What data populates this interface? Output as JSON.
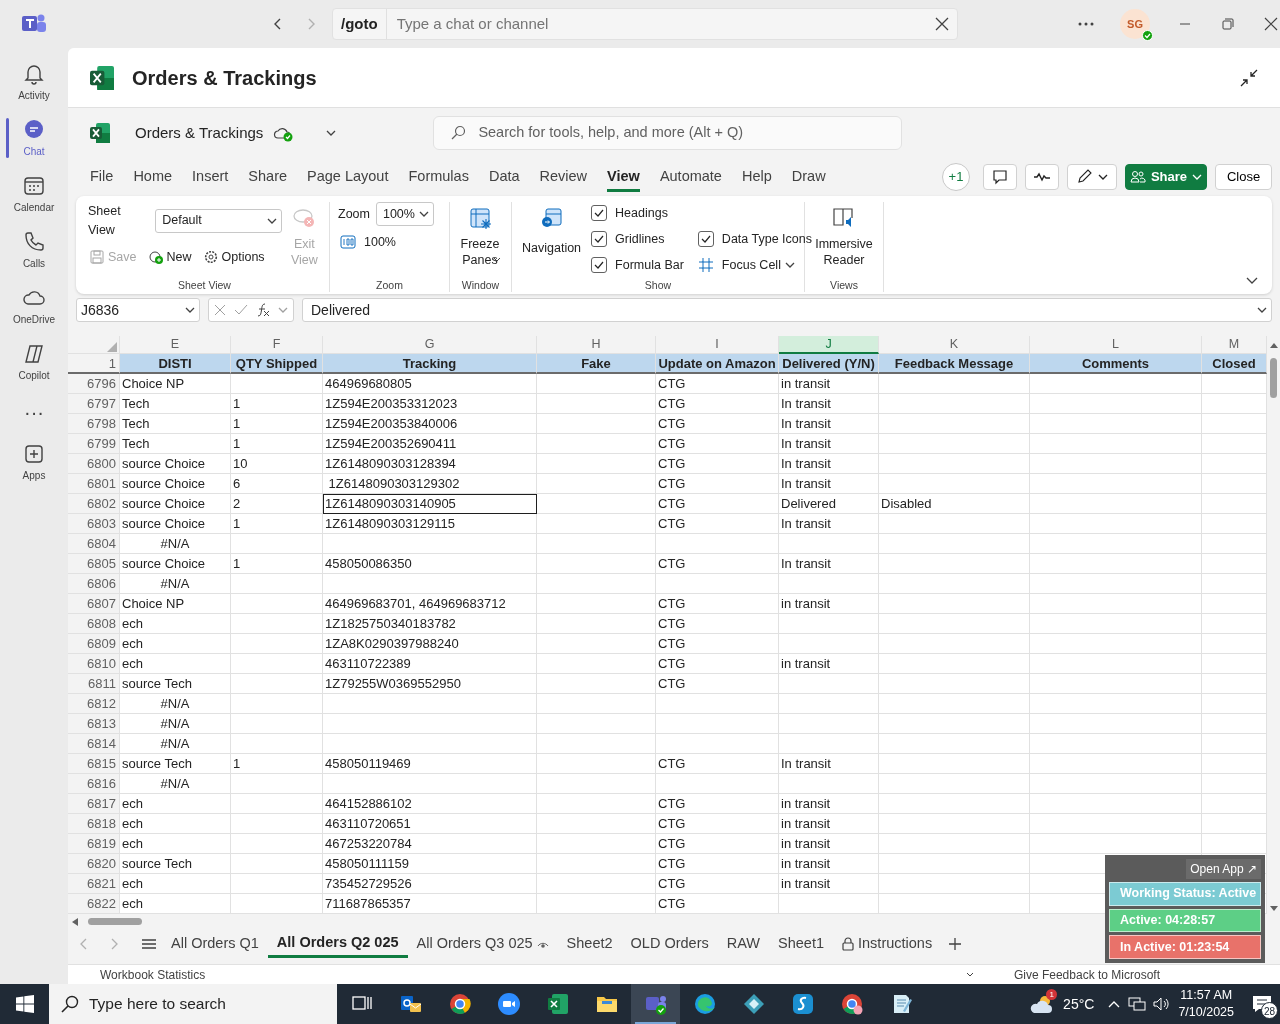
{
  "teams_bar": {
    "goto": "/goto",
    "search_placeholder": "Type a chat or channel",
    "avatar": "SG"
  },
  "rail": [
    {
      "label": "Activity",
      "kind": "bell",
      "selected": false
    },
    {
      "label": "Chat",
      "kind": "chat",
      "selected": true
    },
    {
      "label": "Calendar",
      "kind": "calendar",
      "selected": false
    },
    {
      "label": "Calls",
      "kind": "phone",
      "selected": false
    },
    {
      "label": "OneDrive",
      "kind": "cloud",
      "selected": false
    },
    {
      "label": "Copilot",
      "kind": "copilot",
      "selected": false
    },
    {
      "label": "···",
      "kind": "more",
      "selected": false
    },
    {
      "label": "Apps",
      "kind": "apps",
      "selected": false
    }
  ],
  "app_title": "Orders & Trackings",
  "workbook": {
    "name": "Orders & Trackings",
    "search_placeholder": "Search for tools, help, and more (Alt + Q)"
  },
  "menu_tabs": [
    {
      "label": "File",
      "selected": false
    },
    {
      "label": "Home",
      "selected": false
    },
    {
      "label": "Insert",
      "selected": false
    },
    {
      "label": "Share",
      "selected": false
    },
    {
      "label": "Page Layout",
      "selected": false
    },
    {
      "label": "Formulas",
      "selected": false
    },
    {
      "label": "Data",
      "selected": false
    },
    {
      "label": "Review",
      "selected": false
    },
    {
      "label": "View",
      "selected": true
    },
    {
      "label": "Automate",
      "selected": false
    },
    {
      "label": "Help",
      "selected": false
    },
    {
      "label": "Draw",
      "selected": false
    }
  ],
  "toolbar": {
    "collaborators": "+1",
    "share": "Share",
    "close": "Close"
  },
  "ribbon": {
    "sheet_view": {
      "label": "Sheet View",
      "select": "Default",
      "buttons": [
        {
          "label": "Save",
          "kind": "save",
          "disabled": true
        },
        {
          "label": "New",
          "kind": "new",
          "disabled": false
        },
        {
          "label": "Options",
          "kind": "options",
          "disabled": false
        }
      ],
      "exit": {
        "label": "Exit View",
        "disabled": true
      },
      "group": "Sheet View"
    },
    "zoom": {
      "label": "Zoom",
      "select": "100%",
      "reset": "100%",
      "group": "Zoom"
    },
    "window": {
      "button": "Freeze Panes",
      "group": "Window"
    },
    "show": {
      "navigation": "Navigation",
      "checks": [
        {
          "label": "Headings",
          "checked": true
        },
        {
          "label": "Gridlines",
          "checked": true
        },
        {
          "label": "Formula Bar",
          "checked": true
        },
        {
          "label": "Data Type Icons",
          "checked": true
        }
      ],
      "focus_cell": "Focus Cell",
      "group": "Show"
    },
    "views": {
      "button": "Immersive Reader",
      "group": "Views"
    }
  },
  "formula_bar": {
    "name_box": "J6836",
    "formula": "Delivered"
  },
  "sheet": {
    "header_row": "1",
    "columns": [
      {
        "letter": "E",
        "header": "DISTI",
        "selected": false
      },
      {
        "letter": "F",
        "header": "QTY Shipped",
        "selected": false
      },
      {
        "letter": "G",
        "header": "Tracking",
        "selected": false
      },
      {
        "letter": "H",
        "header": "Fake",
        "selected": false
      },
      {
        "letter": "I",
        "header": "Update on Amazon",
        "selected": false
      },
      {
        "letter": "J",
        "header": "Delivered (Y/N)",
        "selected": true
      },
      {
        "letter": "K",
        "header": "Feedback Message",
        "selected": false
      },
      {
        "letter": "L",
        "header": "Comments",
        "selected": false
      },
      {
        "letter": "M",
        "header": "Closed",
        "selected": false
      }
    ],
    "rows": [
      {
        "num": "6796",
        "kind": "data",
        "g_cell_selected": false,
        "cells": [
          "Choice NP",
          null,
          "464969680805",
          null,
          "CTG",
          "in transit",
          null,
          null,
          null
        ]
      },
      {
        "num": "6797",
        "kind": "data",
        "g_cell_selected": false,
        "cells": [
          "Tech",
          "1",
          "1Z594E200353312023",
          null,
          "CTG",
          "In transit",
          null,
          null,
          null
        ]
      },
      {
        "num": "6798",
        "kind": "data",
        "g_cell_selected": false,
        "cells": [
          "Tech",
          "1",
          "1Z594E200353840006",
          null,
          "CTG",
          "In transit",
          null,
          null,
          null
        ]
      },
      {
        "num": "6799",
        "kind": "data",
        "g_cell_selected": false,
        "cells": [
          "Tech",
          "1",
          "1Z594E200352690411",
          null,
          "CTG",
          "In transit",
          null,
          null,
          null
        ]
      },
      {
        "num": "6800",
        "kind": "data",
        "g_cell_selected": false,
        "cells": [
          "source Choice",
          "10",
          "1Z6148090303128394",
          null,
          "CTG",
          "In transit",
          null,
          null,
          null
        ]
      },
      {
        "num": "6801",
        "kind": "data",
        "g_cell_selected": false,
        "cells": [
          "source Choice",
          "6",
          " 1Z6148090303129302",
          null,
          "CTG",
          "In transit",
          null,
          null,
          null
        ]
      },
      {
        "num": "6802",
        "kind": "data",
        "g_cell_selected": true,
        "cells": [
          "source Choice",
          "2",
          "1Z6148090303140905",
          null,
          "CTG",
          "Delivered",
          "Disabled",
          null,
          null
        ]
      },
      {
        "num": "6803",
        "kind": "data",
        "g_cell_selected": false,
        "cells": [
          "source Choice",
          "1",
          "1Z6148090303129115",
          null,
          "CTG",
          "In transit",
          null,
          null,
          null
        ]
      },
      {
        "num": "6804",
        "kind": "error",
        "g_cell_selected": false,
        "cells": [
          "#N/A",
          null,
          null,
          null,
          null,
          null,
          null,
          null,
          null
        ]
      },
      {
        "num": "6805",
        "kind": "data",
        "g_cell_selected": false,
        "cells": [
          "source Choice",
          "1",
          "458050086350",
          null,
          "CTG",
          "In transit",
          null,
          null,
          null
        ]
      },
      {
        "num": "6806",
        "kind": "error",
        "g_cell_selected": false,
        "cells": [
          "#N/A",
          null,
          null,
          null,
          null,
          null,
          null,
          null,
          null
        ]
      },
      {
        "num": "6807",
        "kind": "data",
        "g_cell_selected": false,
        "cells": [
          "Choice NP",
          null,
          "464969683701, 464969683712",
          null,
          "CTG",
          "in transit",
          null,
          null,
          null
        ]
      },
      {
        "num": "6808",
        "kind": "data",
        "g_cell_selected": false,
        "cells": [
          "ech",
          null,
          "1Z1825750340183782",
          null,
          "CTG",
          null,
          null,
          null,
          null
        ]
      },
      {
        "num": "6809",
        "kind": "data",
        "g_cell_selected": false,
        "cells": [
          "ech",
          null,
          "1ZA8K0290397988240",
          null,
          "CTG",
          null,
          null,
          null,
          null
        ]
      },
      {
        "num": "6810",
        "kind": "data",
        "g_cell_selected": false,
        "cells": [
          "ech",
          null,
          "463110722389",
          null,
          "CTG",
          "in transit",
          null,
          null,
          null
        ]
      },
      {
        "num": "6811",
        "kind": "data",
        "g_cell_selected": false,
        "cells": [
          "source Tech",
          null,
          "1Z79255W0369552950",
          null,
          "CTG",
          null,
          null,
          null,
          null
        ]
      },
      {
        "num": "6812",
        "kind": "error",
        "g_cell_selected": false,
        "cells": [
          "#N/A",
          null,
          null,
          null,
          null,
          null,
          null,
          null,
          null
        ]
      },
      {
        "num": "6813",
        "kind": "error",
        "g_cell_selected": false,
        "cells": [
          "#N/A",
          null,
          null,
          null,
          null,
          null,
          null,
          null,
          null
        ]
      },
      {
        "num": "6814",
        "kind": "error",
        "g_cell_selected": false,
        "cells": [
          "#N/A",
          null,
          null,
          null,
          null,
          null,
          null,
          null,
          null
        ]
      },
      {
        "num": "6815",
        "kind": "data",
        "g_cell_selected": false,
        "cells": [
          "source Tech",
          "1",
          "458050119469",
          null,
          "CTG",
          "In transit",
          null,
          null,
          null
        ]
      },
      {
        "num": "6816",
        "kind": "error",
        "g_cell_selected": false,
        "cells": [
          "#N/A",
          null,
          null,
          null,
          null,
          null,
          null,
          null,
          null
        ]
      },
      {
        "num": "6817",
        "kind": "data",
        "g_cell_selected": false,
        "cells": [
          "ech",
          null,
          "464152886102",
          null,
          "CTG",
          "in transit",
          null,
          null,
          null
        ]
      },
      {
        "num": "6818",
        "kind": "data",
        "g_cell_selected": false,
        "cells": [
          "ech",
          null,
          "463110720651",
          null,
          "CTG",
          "in transit",
          null,
          null,
          null
        ]
      },
      {
        "num": "6819",
        "kind": "data",
        "g_cell_selected": false,
        "cells": [
          "ech",
          null,
          "467253220784",
          null,
          "CTG",
          "in transit",
          null,
          null,
          null
        ]
      },
      {
        "num": "6820",
        "kind": "data",
        "g_cell_selected": false,
        "cells": [
          "source Tech",
          null,
          "458050111159",
          null,
          "CTG",
          "in transit",
          null,
          null,
          null
        ]
      },
      {
        "num": "6821",
        "kind": "data",
        "g_cell_selected": false,
        "cells": [
          "ech",
          null,
          "735452729526",
          null,
          "CTG",
          "in transit",
          null,
          null,
          null
        ]
      },
      {
        "num": "6822",
        "kind": "data",
        "g_cell_selected": false,
        "cells": [
          "ech",
          null,
          "711687865357",
          null,
          "CTG",
          null,
          null,
          null,
          null
        ]
      }
    ]
  },
  "sheet_tabs": [
    {
      "label": "All Orders Q1",
      "kind": "plain",
      "selected": false
    },
    {
      "label": "All Orders Q2 025",
      "kind": "plain",
      "selected": true
    },
    {
      "label": "All Orders Q3 025",
      "kind": "viewed",
      "selected": false
    },
    {
      "label": "Sheet2",
      "kind": "plain",
      "selected": false
    },
    {
      "label": "OLD Orders",
      "kind": "plain",
      "selected": false
    },
    {
      "label": "RAW",
      "kind": "plain",
      "selected": false
    },
    {
      "label": "Sheet1",
      "kind": "plain",
      "selected": false
    },
    {
      "label": "Instructions",
      "kind": "locked",
      "selected": false
    }
  ],
  "status_bar": {
    "left": "Workbook Statistics",
    "feedback": "Give Feedback to Microsoft"
  },
  "status_widget": {
    "open": "Open App ↗",
    "items": [
      {
        "label": "Working Status: Active",
        "color": "#7ccbd3"
      },
      {
        "label": "Active: 04:28:57",
        "color": "#5dcf86"
      },
      {
        "label": "In Active: 01:23:54",
        "color": "#e8726a"
      }
    ]
  },
  "taskbar": {
    "search_placeholder": "Type here to search",
    "apps": [
      {
        "kind": "taskview",
        "selected": false
      },
      {
        "kind": "mail",
        "selected": false
      },
      {
        "kind": "browser",
        "selected": false
      },
      {
        "kind": "video",
        "selected": false
      },
      {
        "kind": "sheet",
        "selected": false
      },
      {
        "kind": "folder",
        "selected": false
      },
      {
        "kind": "chat",
        "selected": true
      },
      {
        "kind": "edge",
        "selected": false
      },
      {
        "kind": "diamond",
        "selected": false
      },
      {
        "kind": "script",
        "selected": false
      },
      {
        "kind": "browser2",
        "selected": false
      },
      {
        "kind": "notepad",
        "selected": false
      }
    ],
    "weather": "25°C",
    "weather_badge": "1",
    "time": "11:57 AM",
    "date": "7/10/2025",
    "notifications": "28"
  }
}
